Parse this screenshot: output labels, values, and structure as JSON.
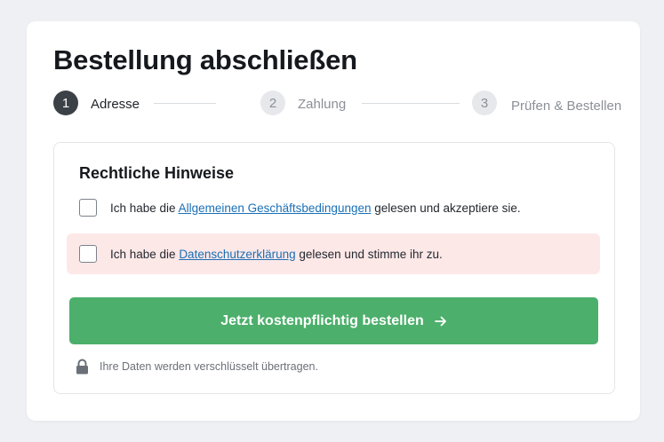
{
  "page": {
    "title": "Bestellung abschließen"
  },
  "stepper": {
    "steps": [
      {
        "number": "1",
        "label": "Adresse",
        "state": "active"
      },
      {
        "number": "2",
        "label": "Zahlung",
        "state": "inactive"
      },
      {
        "number": "3",
        "label": "Prüfen & Bestellen",
        "state": "inactive"
      }
    ]
  },
  "legal": {
    "title": "Rechtliche Hinweise",
    "terms": {
      "prefix": "Ich habe die ",
      "link": "Allgemeinen Geschäftsbedingungen",
      "suffix": " gelesen und akzeptiere sie.",
      "checked": false
    },
    "privacy": {
      "prefix": "Ich habe die ",
      "link": "Datenschutzerklärung",
      "suffix": " gelesen und stimme ihr zu.",
      "checked": false,
      "state": "error"
    }
  },
  "submit": {
    "label": "Jetzt kostenpflichtig bestellen",
    "icon": "arrow-right-icon"
  },
  "secure": {
    "icon": "lock-icon",
    "text": "Ihre Daten werden verschlüsselt übertragen."
  },
  "colors": {
    "accent_green": "#4caf6b",
    "step_active": "#3c4147",
    "link": "#1a6fb5",
    "error_background": "#fde8e8"
  }
}
